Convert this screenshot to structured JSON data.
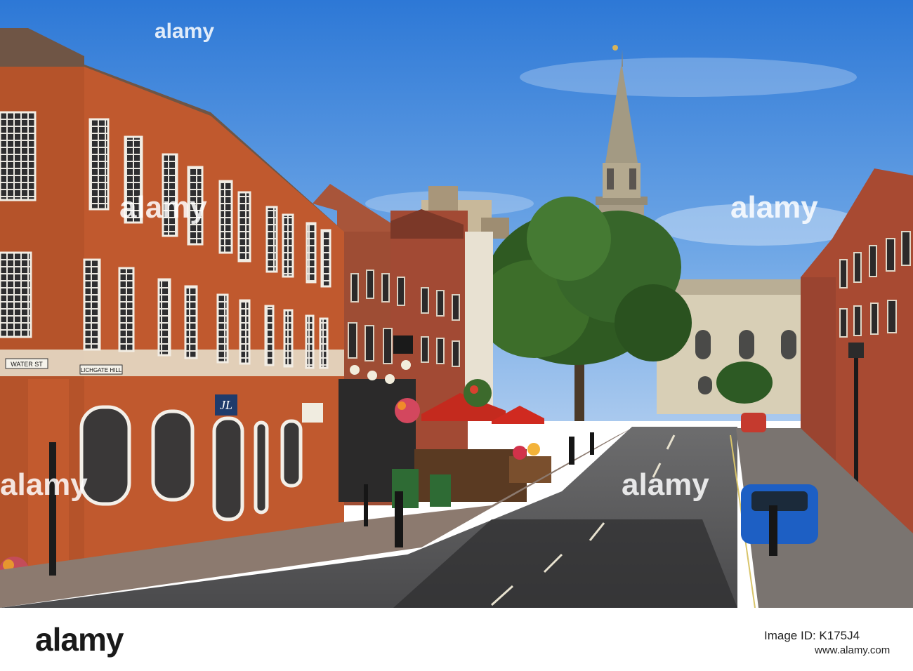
{
  "photo": {
    "street_signs": {
      "water_st": "WATER ST",
      "lichgate_hill": "LICHGATE HILL"
    },
    "watermark": {
      "word": "alamy",
      "brand_color": "#ffffff"
    }
  },
  "footer": {
    "logo": "alamy",
    "image_id_label": "Image ID: K175J4",
    "site": "www.alamy.com"
  }
}
